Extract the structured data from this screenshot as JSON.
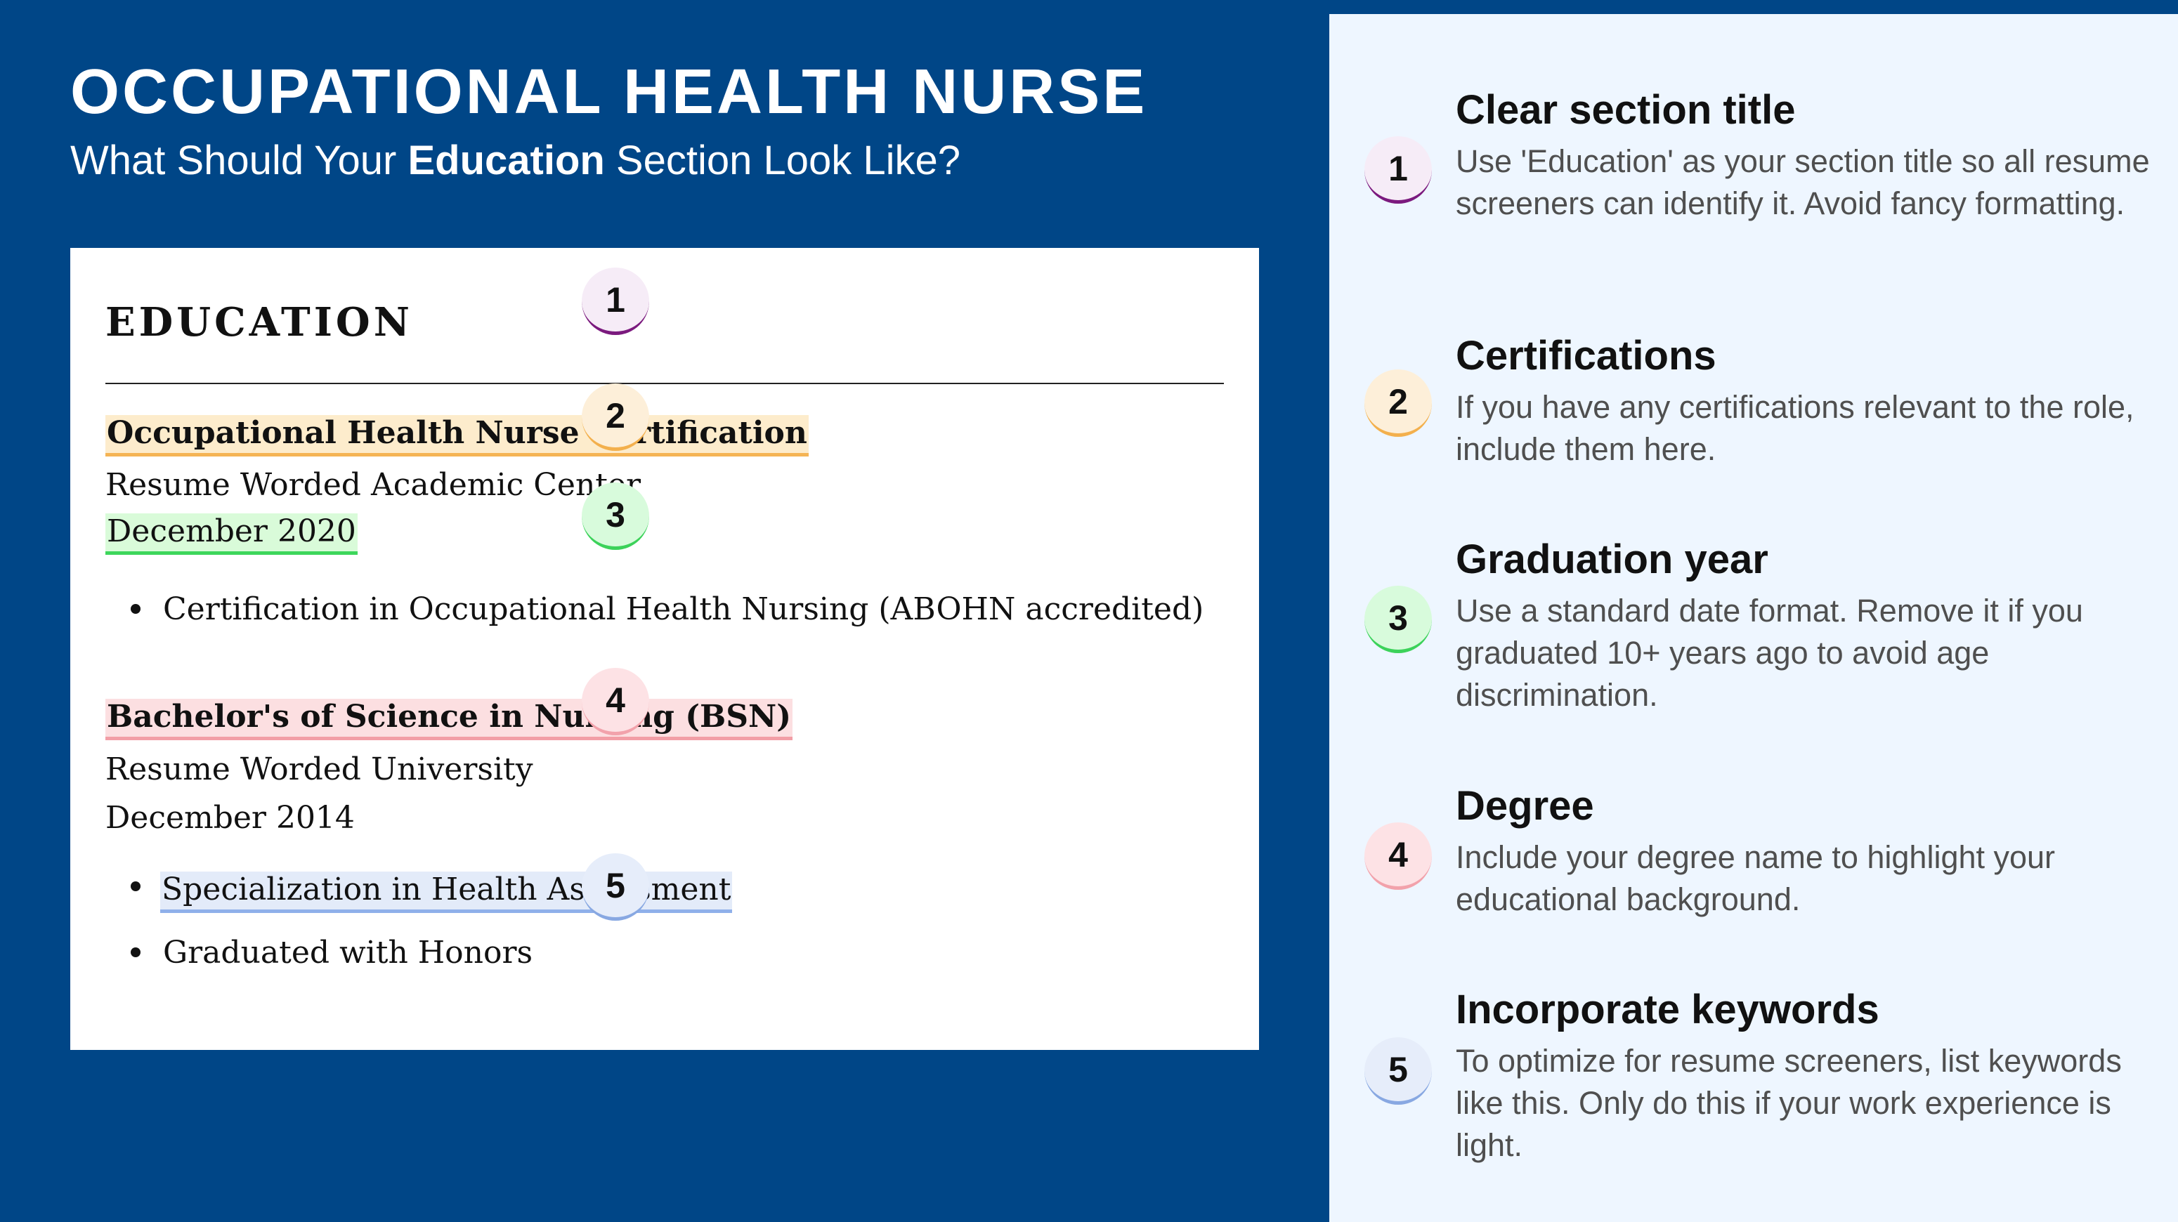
{
  "header": {
    "title": "OCCUPATIONAL HEALTH NURSE",
    "subtitle_before": "What Should Your ",
    "subtitle_bold": "Education",
    "subtitle_after": " Section Look Like?"
  },
  "resume": {
    "section_title": "EDUCATION",
    "entry1": {
      "name": "Occupational Health Nurse Certification",
      "school": "Resume Worded Academic Center",
      "date": "December 2020",
      "bullet": "Certification in Occupational Health Nursing (ABOHN accredited)"
    },
    "entry2": {
      "name": "Bachelor's of Science in Nursing (BSN)",
      "school": "Resume Worded University",
      "date": "December 2014",
      "bullet1": "Specialization in Health Assessment",
      "bullet2": "Graduated with Honors"
    },
    "badges": [
      "1",
      "2",
      "3",
      "4",
      "5"
    ]
  },
  "tips": [
    {
      "number": "1",
      "title": "Clear section title",
      "text": "Use 'Education' as your section title so all resume screeners can identify it. Avoid fancy formatting."
    },
    {
      "number": "2",
      "title": "Certifications",
      "text": "If you have any certifications relevant to the role, include them here."
    },
    {
      "number": "3",
      "title": "Graduation year",
      "text": "Use a standard date format. Remove it if you graduated 10+ years ago to avoid age discrimination."
    },
    {
      "number": "4",
      "title": "Degree",
      "text": "Include your degree name to highlight your educational background."
    },
    {
      "number": "5",
      "title": "Incorporate keywords",
      "text": "To optimize for resume screeners, list keywords like this. Only do this if your work experience is light."
    }
  ],
  "colors": {
    "background": "#004687",
    "panel": "#eef6ff",
    "badge1": "#7b1a7e",
    "badge2": "#f3b04d",
    "badge3": "#3cd25a",
    "badge4": "#f2a2ab",
    "badge5": "#88a8e2"
  }
}
